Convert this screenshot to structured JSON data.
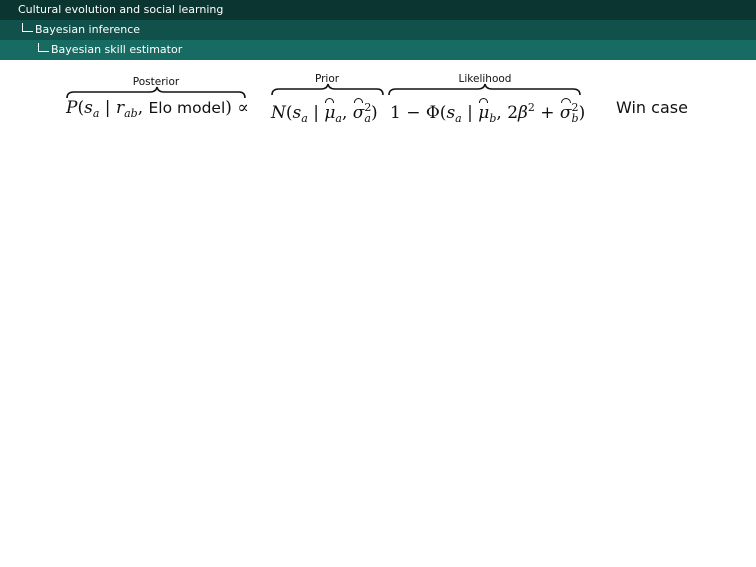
{
  "header": {
    "section": "Cultural evolution and social learning",
    "subsection": "Bayesian inference",
    "subsubsection": "Bayesian skill estimator"
  },
  "equation": {
    "labels": {
      "posterior": "Posterior",
      "prior": "Prior",
      "likelihood": "Likelihood"
    },
    "case_label": "Win case"
  }
}
